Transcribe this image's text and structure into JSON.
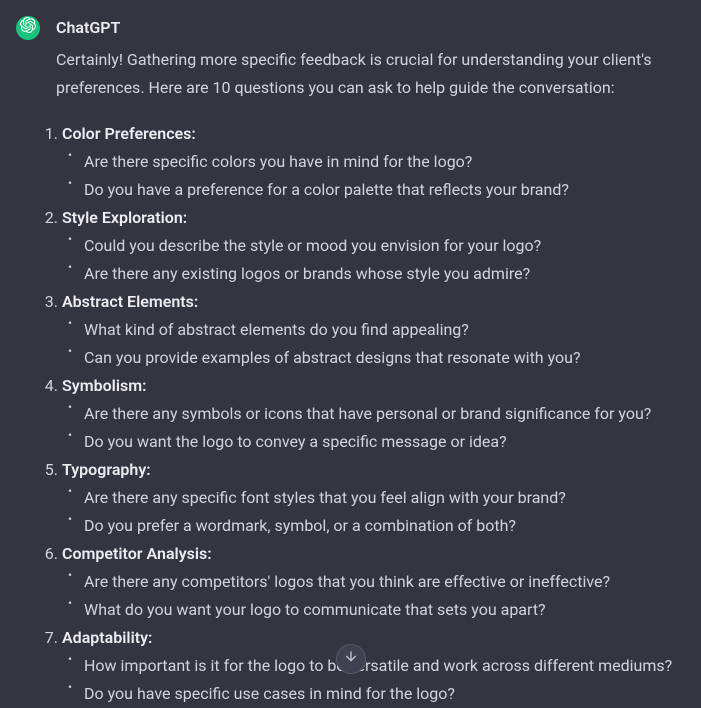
{
  "assistant": {
    "name": "ChatGPT",
    "intro": "Certainly! Gathering more specific feedback is crucial for understanding your client's preferences. Here are 10 questions you can ask to help guide the conversation:",
    "sections": [
      {
        "title": "Color Preferences:",
        "items": [
          "Are there specific colors you have in mind for the logo?",
          "Do you have a preference for a color palette that reflects your brand?"
        ]
      },
      {
        "title": "Style Exploration:",
        "items": [
          "Could you describe the style or mood you envision for your logo?",
          "Are there any existing logos or brands whose style you admire?"
        ]
      },
      {
        "title": "Abstract Elements:",
        "items": [
          "What kind of abstract elements do you find appealing?",
          "Can you provide examples of abstract designs that resonate with you?"
        ]
      },
      {
        "title": "Symbolism:",
        "items": [
          "Are there any symbols or icons that have personal or brand significance for you?",
          "Do you want the logo to convey a specific message or idea?"
        ]
      },
      {
        "title": "Typography:",
        "items": [
          "Are there any specific font styles that you feel align with your brand?",
          "Do you prefer a wordmark, symbol, or a combination of both?"
        ]
      },
      {
        "title": "Competitor Analysis:",
        "items": [
          "Are there any competitors' logos that you think are effective or ineffective?",
          "What do you want your logo to communicate that sets you apart?"
        ]
      },
      {
        "title": "Adaptability:",
        "items": [
          "How important is it for the logo to be versatile and work across different mediums?",
          "Do you have specific use cases in mind for the logo?"
        ]
      }
    ]
  }
}
